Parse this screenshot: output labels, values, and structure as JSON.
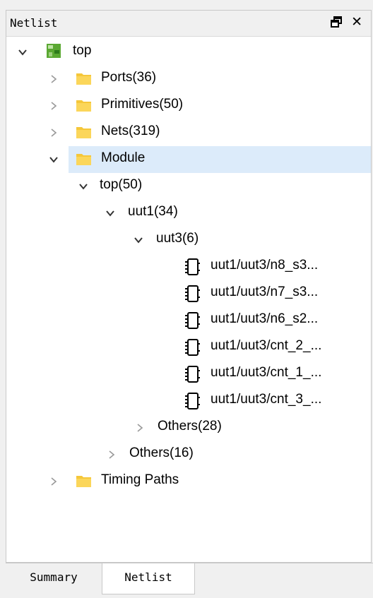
{
  "panel": {
    "title": "Netlist",
    "float_icon": "float-window-icon",
    "close_label": "✕"
  },
  "tree": {
    "root": {
      "label": "top",
      "expanded": true,
      "icon": "design-icon"
    },
    "ports": {
      "label": "Ports(36)",
      "expanded": false
    },
    "primitives": {
      "label": "Primitives(50)",
      "expanded": false
    },
    "nets": {
      "label": "Nets(319)",
      "expanded": false
    },
    "module": {
      "label": "Module",
      "expanded": true,
      "selected": true
    },
    "top50": {
      "label": "top(50)",
      "expanded": true
    },
    "uut1": {
      "label": "uut1(34)",
      "expanded": true
    },
    "uut3": {
      "label": "uut3(6)",
      "expanded": true
    },
    "cells": [
      {
        "label": "uut1/uut3/n8_s3..."
      },
      {
        "label": "uut1/uut3/n7_s3..."
      },
      {
        "label": "uut1/uut3/n6_s2..."
      },
      {
        "label": "uut1/uut3/cnt_2_..."
      },
      {
        "label": "uut1/uut3/cnt_1_..."
      },
      {
        "label": "uut1/uut3/cnt_3_..."
      }
    ],
    "others28": {
      "label": "Others(28)",
      "expanded": false
    },
    "others16": {
      "label": "Others(16)",
      "expanded": false
    },
    "timing": {
      "label": "Timing Paths",
      "expanded": false
    }
  },
  "tabs": {
    "summary": "Summary",
    "netlist": "Netlist",
    "active": "Netlist"
  },
  "colors": {
    "selection": "#dcebfa",
    "folder": "#f5c73a",
    "design_icon": "#5aa832"
  }
}
